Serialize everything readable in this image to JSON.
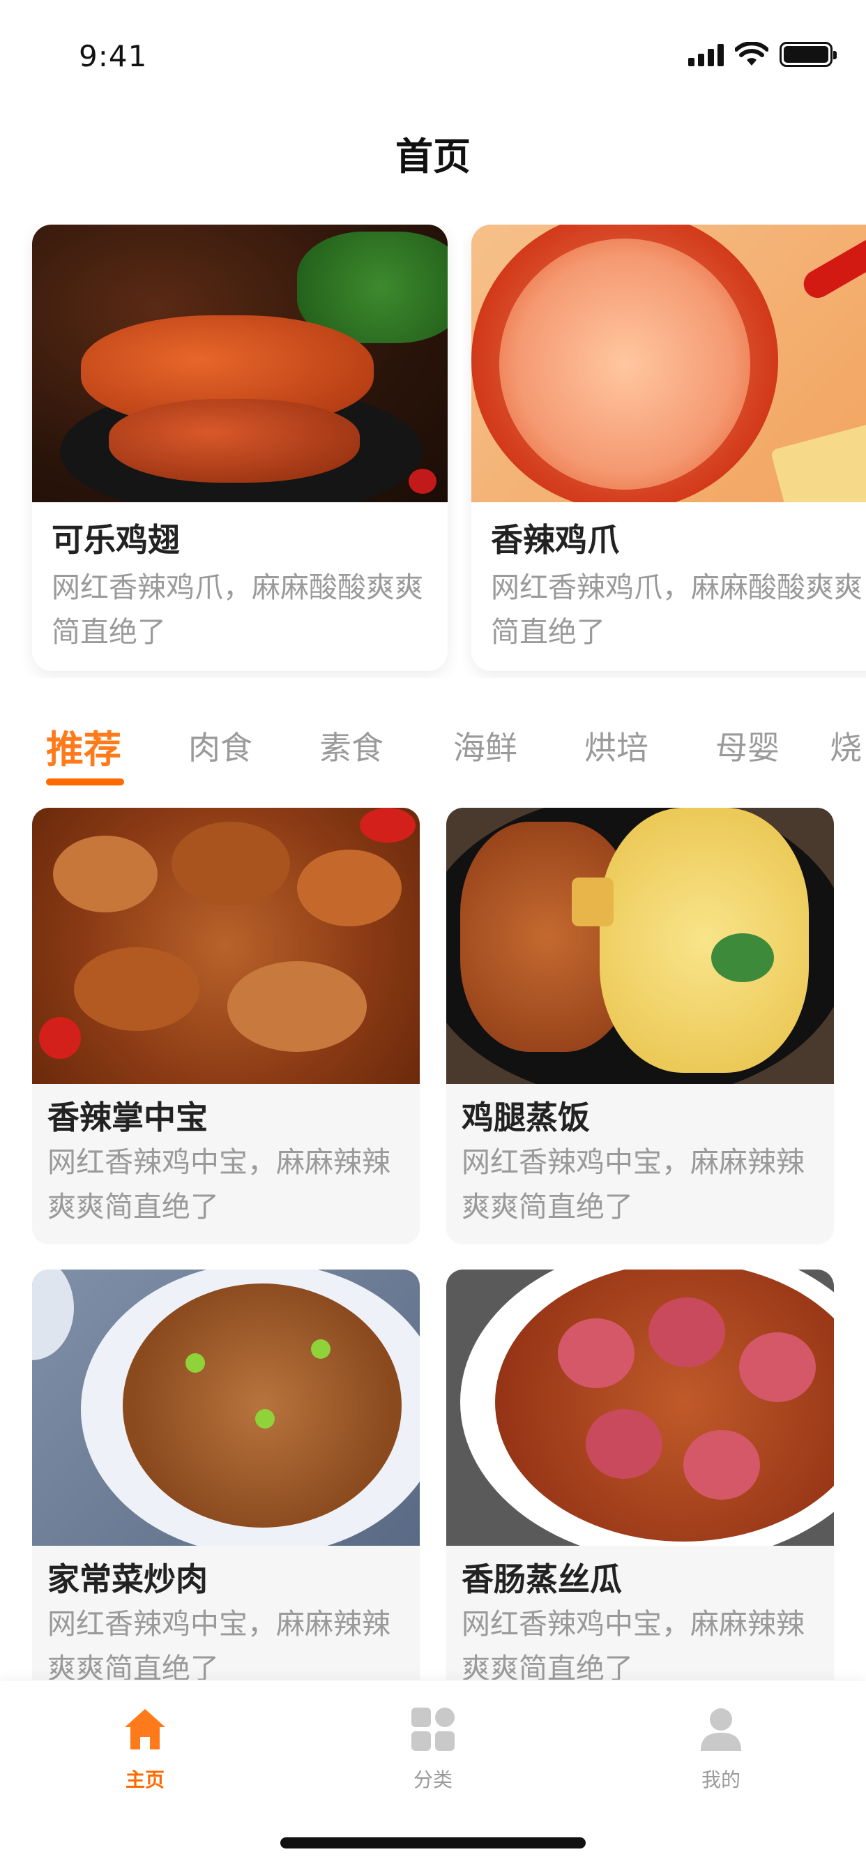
{
  "status_bar": {
    "time": "9:41"
  },
  "nav": {
    "title": "首页"
  },
  "featured": [
    {
      "title": "可乐鸡翅",
      "desc": "网红香辣鸡爪，麻麻酸酸爽爽简直绝了"
    },
    {
      "title": "香辣鸡爪",
      "desc": "网红香辣鸡爪，麻麻酸酸爽爽简直绝了"
    }
  ],
  "tabs": [
    "推荐",
    "肉食",
    "素食",
    "海鲜",
    "烘培",
    "母婴",
    "烧"
  ],
  "active_tab": "推荐",
  "items": [
    {
      "title": "香辣掌中宝",
      "desc": "网红香辣鸡中宝，麻麻辣辣爽爽简直绝了"
    },
    {
      "title": "鸡腿蒸饭",
      "desc": "网红香辣鸡中宝，麻麻辣辣爽爽简直绝了"
    },
    {
      "title": "家常菜炒肉",
      "desc": "网红香辣鸡中宝，麻麻辣辣爽爽简直绝了"
    },
    {
      "title": "香肠蒸丝瓜",
      "desc": "网红香辣鸡中宝，麻麻辣辣爽爽简直绝了"
    }
  ],
  "tabbar": [
    {
      "label": "主页",
      "icon": "home-icon",
      "active": true
    },
    {
      "label": "分类",
      "icon": "grid-icon",
      "active": false
    },
    {
      "label": "我的",
      "icon": "user-icon",
      "active": false
    }
  ],
  "colors": {
    "accent": "#ff6a00",
    "muted": "#9a9a9a",
    "text": "#222222",
    "card_bg": "#f6f6f6"
  }
}
